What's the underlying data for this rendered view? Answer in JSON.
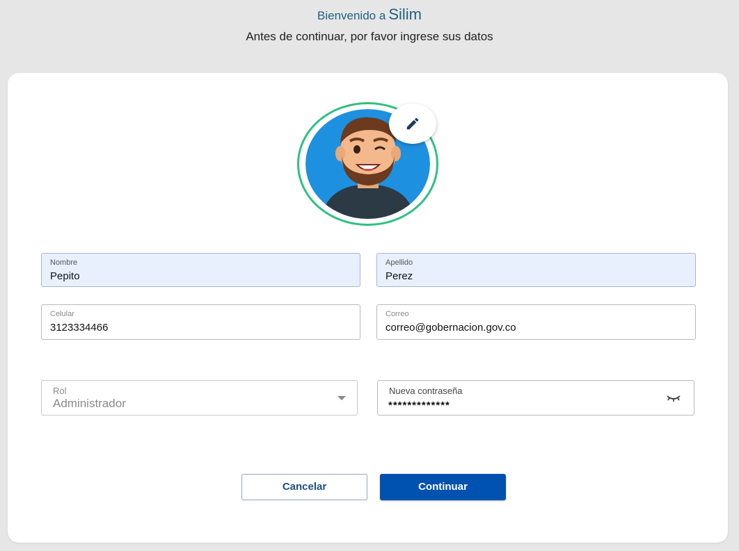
{
  "header": {
    "welcome": "Bienvenido a",
    "brand": "Silim",
    "subtitle": "Antes de continuar, por favor ingrese sus datos"
  },
  "avatar": {
    "edit_icon": "pencil-icon"
  },
  "form": {
    "nombre": {
      "label": "Nombre",
      "value": "Pepito"
    },
    "apellido": {
      "label": "Apellido",
      "value": "Perez"
    },
    "celular": {
      "label": "Celular",
      "value": "3123334466"
    },
    "correo": {
      "label": "Correo",
      "value": "correo@gobernacion.gov.co"
    },
    "rol": {
      "label": "Rol",
      "value": "Administrador"
    },
    "password": {
      "label": "Nueva contraseña",
      "value": "*************",
      "toggle_icon": "eye-closed-icon"
    }
  },
  "actions": {
    "cancel_label": "Cancelar",
    "continue_label": "Continuar"
  },
  "colors": {
    "accent": "#0052b1",
    "avatar_ring": "#2fc083",
    "header_text": "#1f6281",
    "filled_field": "#e8f0fe"
  }
}
